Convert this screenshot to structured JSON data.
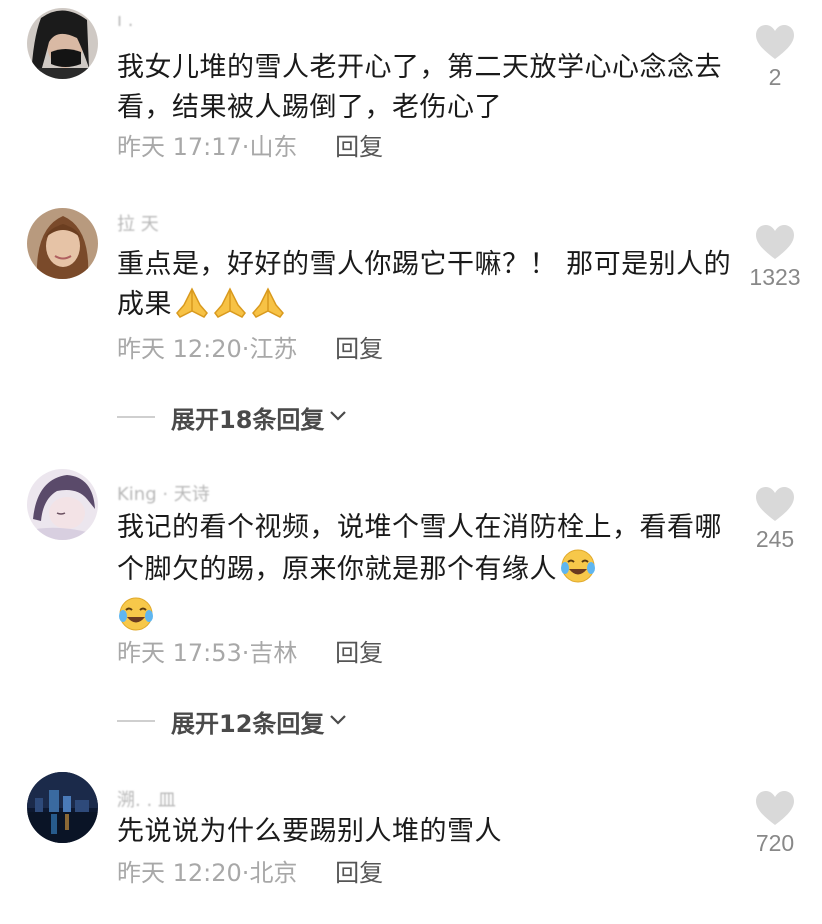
{
  "comments": [
    {
      "username": "ı .",
      "text": "我女儿堆的雪人老开心了，第二天放学心心念念去看，结果被人踢倒了，老伤心了",
      "time": "昨天 17:17",
      "location": "山东",
      "reply_label": "回复",
      "likes": "2",
      "emojis": []
    },
    {
      "username": "拉 天",
      "text": "重点是，好好的雪人你踢它干嘛？！ 那可是别人的成果",
      "time": "昨天 12:20",
      "location": "江苏",
      "reply_label": "回复",
      "likes": "1323",
      "emojis": [
        "folded-hands-emoji",
        "folded-hands-emoji",
        "folded-hands-emoji"
      ],
      "expand_label": "展开18条回复"
    },
    {
      "username": "King · 天诗",
      "text": "我记的看个视频，说堆个雪人在消防栓上，看看哪个脚欠的踢，原来你就是那个有缘人",
      "time": "昨天 17:53",
      "location": "吉林",
      "reply_label": "回复",
      "likes": "245",
      "emojis": [
        "tears-of-joy-emoji",
        "tears-of-joy-emoji"
      ],
      "expand_label": "展开12条回复"
    },
    {
      "username": "溯. . 皿",
      "text": "先说说为什么要踢别人堆的雪人",
      "time": "昨天 12:20",
      "location": "北京",
      "reply_label": "回复",
      "likes": "720",
      "emojis": []
    }
  ],
  "colors": {
    "text": "#1a1a1a",
    "meta": "#a8a8a8",
    "reply": "#555555",
    "like_icon": "#d9d9d9",
    "like_count": "#888888",
    "expand_text": "#4a4a4a"
  },
  "icons": {
    "like": "heart-icon",
    "expand": "chevron-down-icon"
  }
}
